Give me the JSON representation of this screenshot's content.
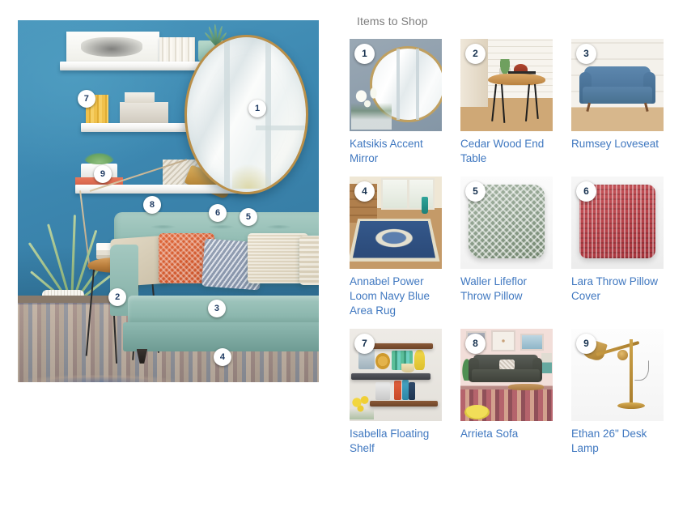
{
  "panel": {
    "title": "Items to Shop",
    "items": [
      {
        "number": "1",
        "title": "Katsikis Accent Mirror",
        "thumb": "mirror-thumbnail"
      },
      {
        "number": "2",
        "title": "Cedar Wood End Table",
        "thumb": "end-table-thumbnail"
      },
      {
        "number": "3",
        "title": "Rumsey Loveseat",
        "thumb": "loveseat-thumbnail"
      },
      {
        "number": "4",
        "title": "Annabel Power Loom Navy Blue Area Rug",
        "thumb": "area-rug-thumbnail"
      },
      {
        "number": "5",
        "title": "Waller Lifeflor Throw Pillow",
        "thumb": "green-pillow-thumbnail"
      },
      {
        "number": "6",
        "title": "Lara Throw Pillow Cover",
        "thumb": "red-pillow-thumbnail"
      },
      {
        "number": "7",
        "title": "Isabella Floating Shelf",
        "thumb": "floating-shelf-thumbnail"
      },
      {
        "number": "8",
        "title": "Arrieta Sofa",
        "thumb": "sofa-thumbnail"
      },
      {
        "number": "9",
        "title": "Ethan 26\" Desk Lamp",
        "thumb": "desk-lamp-thumbnail"
      }
    ]
  },
  "scene": {
    "alt": "Blue living room with mint sofa, round gold mirror and floating shelves",
    "markers": [
      {
        "number": "1",
        "x": 79.6,
        "y": 24.4,
        "target": "Katsikis Accent Mirror"
      },
      {
        "number": "2",
        "x": 33.1,
        "y": 76.5,
        "target": "Cedar Wood End Table"
      },
      {
        "number": "3",
        "x": 66.1,
        "y": 79.6,
        "target": "Rumsey Loveseat"
      },
      {
        "number": "4",
        "x": 68.0,
        "y": 93.1,
        "target": "Annabel Power Loom Navy Blue Area Rug"
      },
      {
        "number": "5",
        "x": 76.6,
        "y": 54.4,
        "target": "Waller Lifeflor Throw Pillow"
      },
      {
        "number": "6",
        "x": 66.4,
        "y": 53.2,
        "target": "Lara Throw Pillow Cover"
      },
      {
        "number": "7",
        "x": 22.8,
        "y": 21.7,
        "target": "Isabella Floating Shelf"
      },
      {
        "number": "8",
        "x": 44.6,
        "y": 51.0,
        "target": "Arrieta Sofa"
      },
      {
        "number": "9",
        "x": 28.2,
        "y": 42.5,
        "target": "Ethan 26\" Desk Lamp"
      }
    ]
  },
  "colors": {
    "link": "#4078c0",
    "title_gray": "#7e7e7e",
    "badge_bg": "#ffffff",
    "badge_text": "#16314f",
    "wall_blue": "#3f8cb4",
    "sofa_mint": "#93bdb4",
    "page_bg": "#ffffff"
  }
}
